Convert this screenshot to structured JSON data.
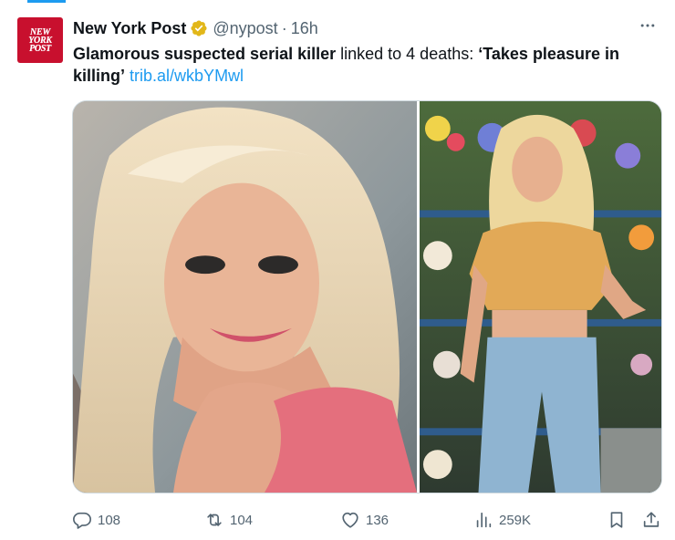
{
  "tweet": {
    "author": {
      "name": "New York Post",
      "handle": "@nypost",
      "time": "16h",
      "separator": "·",
      "avatar_lines": [
        "NEW",
        "YORK",
        "POST"
      ],
      "verified_color": "#e2b719"
    },
    "text": {
      "bold1": "Glamorous suspected serial killer",
      "plain1": " linked to 4 deaths: ",
      "bold2": "‘Takes pleasure in killing’",
      "link": "trib.al/wkbYMwl"
    },
    "media": [
      {
        "icon": "photo-selfie-woman-pink-top"
      },
      {
        "icon": "photo-woman-yellow-top-flower-shop"
      }
    ],
    "actions": {
      "replies": "108",
      "reposts": "104",
      "likes": "136",
      "views": "259K"
    }
  },
  "colors": {
    "accent": "#1d9bf0",
    "muted": "#536471",
    "text": "#0f1419",
    "brand_red": "#c8102e"
  }
}
